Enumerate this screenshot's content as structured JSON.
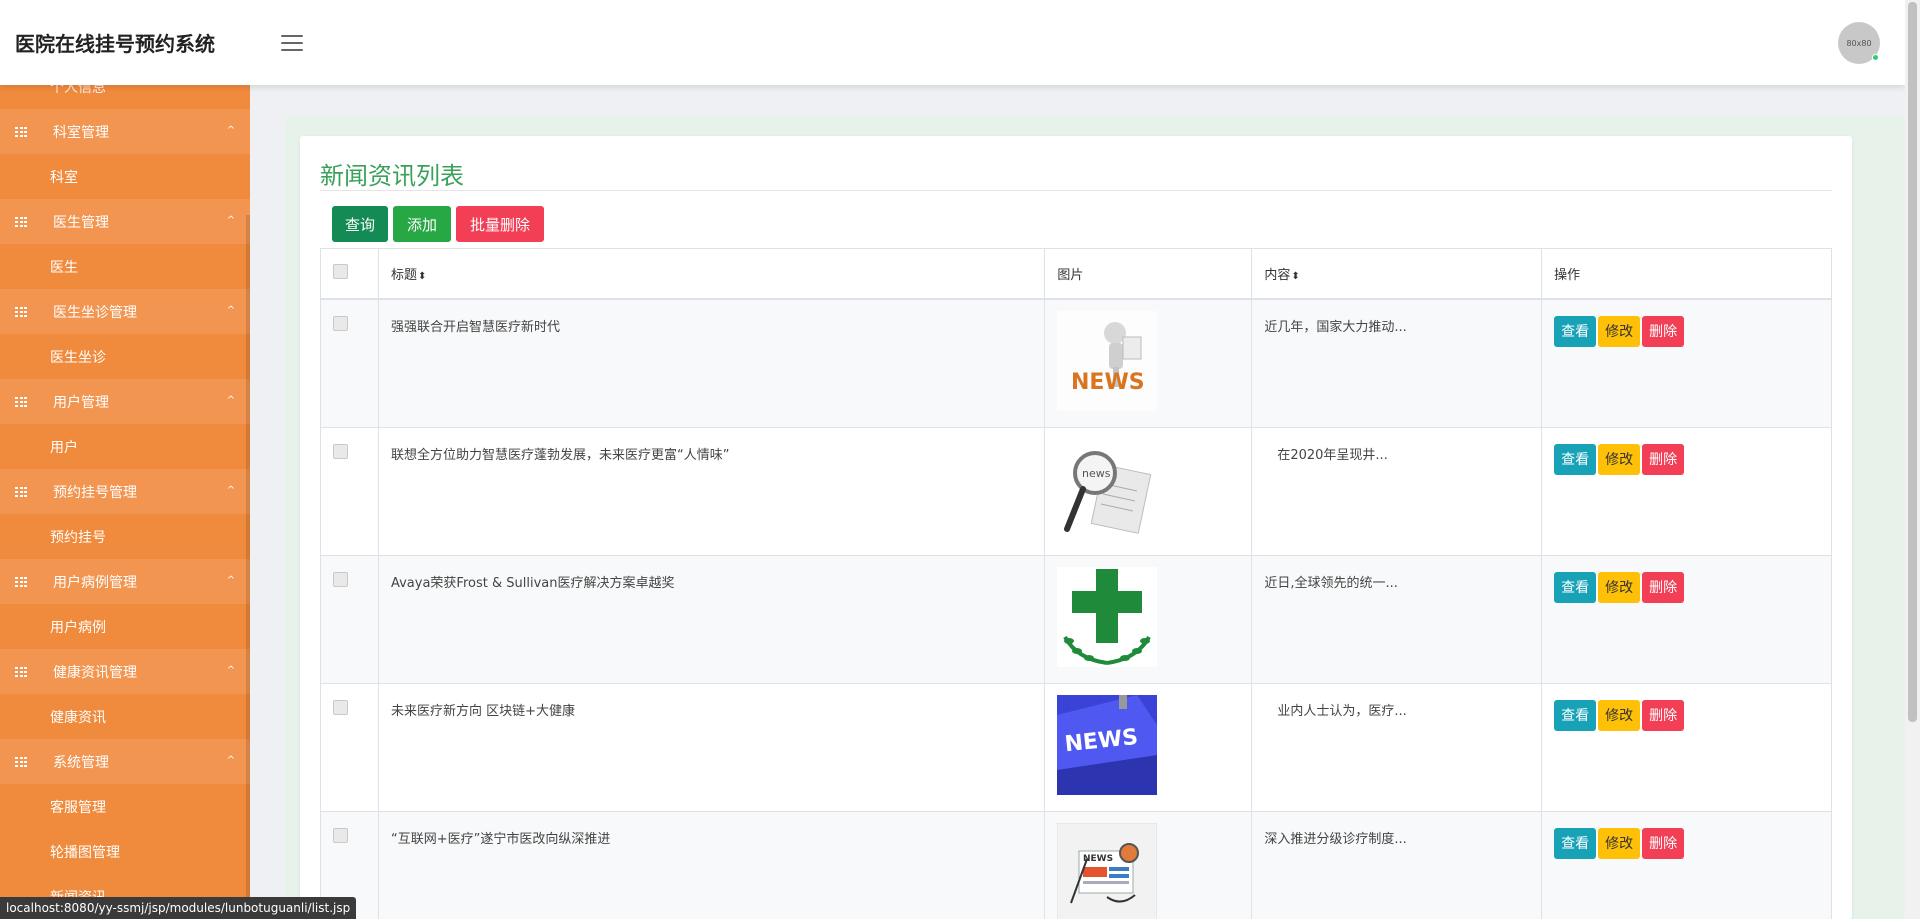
{
  "header": {
    "title": "医院在线挂号预约系统",
    "avatar_text": "80x80"
  },
  "sidebar": {
    "partial_item": "个人信息",
    "groups": [
      {
        "label": "科室管理",
        "sub": [
          "科室"
        ]
      },
      {
        "label": "医生管理",
        "sub": [
          "医生"
        ]
      },
      {
        "label": "医生坐诊管理",
        "sub": [
          "医生坐诊"
        ]
      },
      {
        "label": "用户管理",
        "sub": [
          "用户"
        ]
      },
      {
        "label": "预约挂号管理",
        "sub": [
          "预约挂号"
        ]
      },
      {
        "label": "用户病例管理",
        "sub": [
          "用户病例"
        ]
      },
      {
        "label": "健康资讯管理",
        "sub": [
          "健康资讯"
        ]
      },
      {
        "label": "系统管理",
        "sub": [
          "客服管理",
          "轮播图管理",
          "新闻资讯"
        ]
      }
    ],
    "caret": "^"
  },
  "page": {
    "title": "新闻资讯列表",
    "buttons": {
      "query": "查询",
      "add": "添加",
      "bulk_delete": "批量删除"
    }
  },
  "table": {
    "headers": {
      "title": "标题",
      "image": "图片",
      "content": "内容",
      "ops": "操作"
    },
    "sort_glyph": "⬍",
    "ops_labels": {
      "view": "查看",
      "edit": "修改",
      "delete": "删除"
    },
    "rows": [
      {
        "title": "强强联合开启智慧医疗新时代",
        "image": "news-figure-reading",
        "content": "近几年，国家大力推动..."
      },
      {
        "title": "联想全方位助力智慧医疗蓬勃发展，未来医疗更富“人情味”",
        "image": "news-magnifier",
        "content": "　在2020年呈现井..."
      },
      {
        "title": "Avaya荣获Frost & Sullivan医疗解决方案卓越奖",
        "image": "green-cross-emblem",
        "content": "近日,全球领先的统一..."
      },
      {
        "title": "未来医疗新方向 区块链+大健康",
        "image": "news-keyboard-key",
        "content": "　业内人士认为，医疗..."
      },
      {
        "title": "“互联网+医疗”遂宁市医改向纵深推进",
        "image": "news-paper-illustration",
        "content": "深入推进分级诊疗制度..."
      }
    ]
  },
  "status": {
    "url": "localhost:8080/yy-ssmj/jsp/modules/lunbotuguanli/list.jsp"
  },
  "colors": {
    "sidebar": "#f08a3c",
    "sidebar_group": "#f29550",
    "title_green": "#3aa15a",
    "btn_query": "#148a55",
    "btn_add": "#28a745",
    "btn_delete": "#f23f55",
    "op_view": "#17a2b8",
    "op_edit": "#ffc107"
  }
}
